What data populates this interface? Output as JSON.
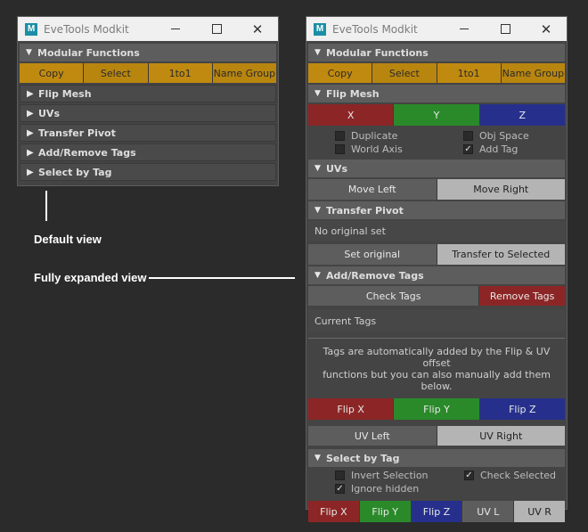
{
  "window": {
    "title": "EveTools Modkit",
    "logo": "M",
    "close_glyph": "✕"
  },
  "glyphs": {
    "expanded": "▼",
    "collapsed": "▶",
    "check": "✓"
  },
  "sections": {
    "modular": "Modular Functions",
    "flip_mesh": "Flip Mesh",
    "uvs": "UVs",
    "transfer_pivot": "Transfer Pivot",
    "tags": "Add/Remove Tags",
    "select_by_tag": "Select by Tag"
  },
  "modular_buttons": {
    "copy": "Copy",
    "select": "Select",
    "onetoone": "1to1",
    "name_group": "Name Group"
  },
  "flip_buttons": {
    "x": "X",
    "y": "Y",
    "z": "Z"
  },
  "flip_options": {
    "duplicate": "Duplicate",
    "duplicate_checked": false,
    "obj_space": "Obj Space",
    "obj_space_checked": false,
    "world_axis": "World Axis",
    "world_axis_checked": false,
    "add_tag": "Add Tag",
    "add_tag_checked": true
  },
  "uv_buttons": {
    "move_left": "Move Left",
    "move_right": "Move Right"
  },
  "pivot": {
    "status": "No original set",
    "set_original": "Set original",
    "transfer_selected": "Transfer to Selected"
  },
  "tags": {
    "check": "Check Tags",
    "remove": "Remove Tags",
    "current_label": "Current Tags",
    "info_line1": "Tags are automatically added by the Flip & UV offset",
    "info_line2": "functions but you can also manually add them below.",
    "flip_x": "Flip X",
    "flip_y": "Flip Y",
    "flip_z": "Flip Z",
    "uv_left": "UV Left",
    "uv_right": "UV Right"
  },
  "select_tag": {
    "invert": "Invert Selection",
    "invert_checked": false,
    "check_selected": "Check Selected",
    "check_selected_checked": true,
    "ignore_hidden": "Ignore hidden",
    "ignore_hidden_checked": true,
    "flip_x": "Flip X",
    "flip_y": "Flip Y",
    "flip_z": "Flip Z",
    "uv_l": "UV L",
    "uv_r": "UV R"
  },
  "annotations": {
    "default": "Default view",
    "expanded": "Fully expanded view"
  }
}
